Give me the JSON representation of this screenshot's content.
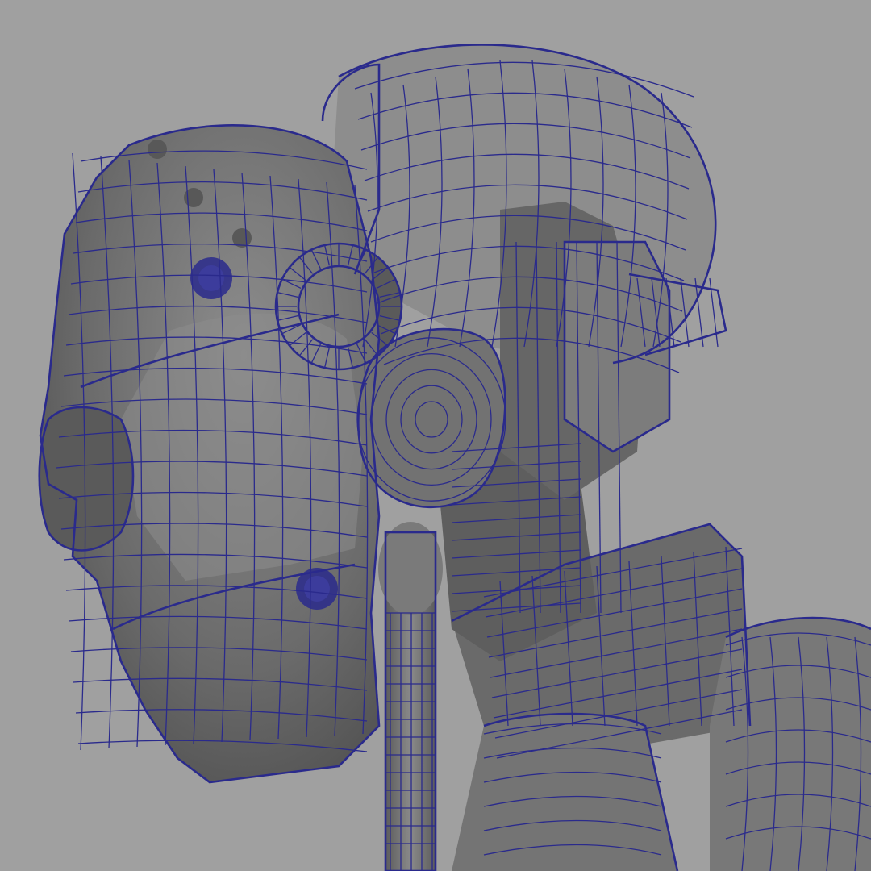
{
  "viewport": {
    "background_color": "#a0a0a0",
    "wire_color": "#2a2a8c",
    "surface_color": "#6e6e6e"
  },
  "subject": {
    "description_icon": "robot-head-wireframe-icon"
  }
}
